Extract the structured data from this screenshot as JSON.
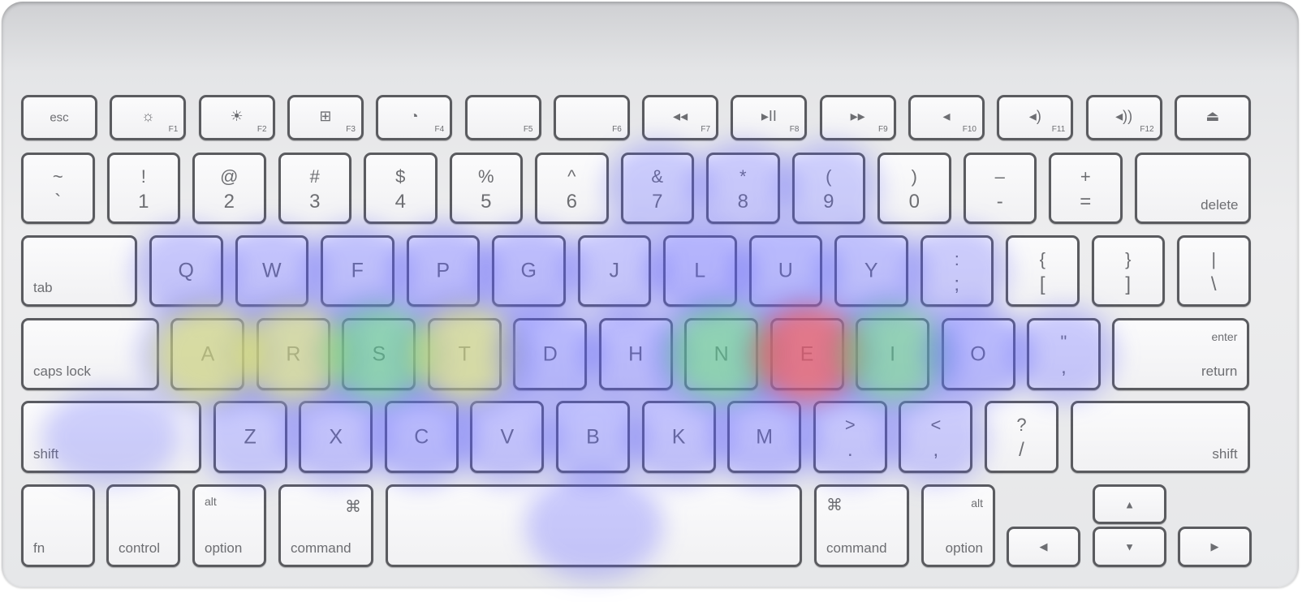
{
  "heat_colors": {
    "low": "#5a5cff",
    "mid": "#5ee06a",
    "high": "#e8f060",
    "max": "#f05a5a"
  },
  "rows": [
    [
      {
        "label": "esc"
      },
      {
        "icon": "brightness-down-icon",
        "fn": "F1"
      },
      {
        "icon": "brightness-up-icon",
        "fn": "F2"
      },
      {
        "icon": "mission-control-icon",
        "fn": "F3"
      },
      {
        "icon": "dashboard-icon",
        "fn": "F4"
      },
      {
        "fn": "F5"
      },
      {
        "fn": "F6"
      },
      {
        "icon": "rewind-icon",
        "fn": "F7"
      },
      {
        "icon": "play-pause-icon",
        "fn": "F8"
      },
      {
        "icon": "fast-forward-icon",
        "fn": "F9"
      },
      {
        "icon": "mute-icon",
        "fn": "F10"
      },
      {
        "icon": "volume-down-icon",
        "fn": "F11"
      },
      {
        "icon": "volume-up-icon",
        "fn": "F12"
      },
      {
        "icon": "eject-icon"
      }
    ],
    [
      {
        "top": "~",
        "bottom": "`"
      },
      {
        "top": "!",
        "bottom": "1"
      },
      {
        "top": "@",
        "bottom": "2"
      },
      {
        "top": "#",
        "bottom": "3"
      },
      {
        "top": "$",
        "bottom": "4"
      },
      {
        "top": "%",
        "bottom": "5"
      },
      {
        "top": "^",
        "bottom": "6"
      },
      {
        "top": "&",
        "bottom": "7",
        "heat": 0.1
      },
      {
        "top": "*",
        "bottom": "8",
        "heat": 0.12
      },
      {
        "top": "(",
        "bottom": "9",
        "heat": 0.06
      },
      {
        "top": ")",
        "bottom": "0"
      },
      {
        "top": "–",
        "bottom": "-"
      },
      {
        "top": "+",
        "bottom": "="
      },
      {
        "corner": "delete"
      }
    ],
    [
      {
        "corner_left": "tab"
      },
      {
        "label": "Q",
        "heat": 0.15
      },
      {
        "label": "W",
        "heat": 0.2
      },
      {
        "label": "F",
        "heat": 0.25
      },
      {
        "label": "P",
        "heat": 0.3
      },
      {
        "label": "G",
        "heat": 0.3
      },
      {
        "label": "J",
        "heat": 0.15
      },
      {
        "label": "L",
        "heat": 0.42
      },
      {
        "label": "U",
        "heat": 0.35
      },
      {
        "label": "Y",
        "heat": 0.25
      },
      {
        "top": ":",
        "bottom": ";",
        "heat": 0.08
      },
      {
        "top": "{",
        "bottom": "["
      },
      {
        "top": "}",
        "bottom": "]"
      },
      {
        "top": "|",
        "bottom": "\\"
      }
    ],
    [
      {
        "corner_left": "caps lock"
      },
      {
        "label": "A",
        "heat": 0.72
      },
      {
        "label": "R",
        "heat": 0.62
      },
      {
        "label": "S",
        "heat": 0.55
      },
      {
        "label": "T",
        "heat": 0.66
      },
      {
        "label": "D",
        "heat": 0.35
      },
      {
        "label": "H",
        "heat": 0.3
      },
      {
        "label": "N",
        "heat": 0.55
      },
      {
        "label": "E",
        "heat": 1.0
      },
      {
        "label": "I",
        "heat": 0.5
      },
      {
        "label": "O",
        "heat": 0.35
      },
      {
        "top": "\"",
        "bottom": ",",
        "heat": 0.12
      },
      {
        "corner": "return",
        "corner_top": "enter"
      }
    ],
    [
      {
        "corner_left": "shift",
        "heat": 0.05
      },
      {
        "label": "Z",
        "heat": 0.1
      },
      {
        "label": "X",
        "heat": 0.2
      },
      {
        "label": "C",
        "heat": 0.35
      },
      {
        "label": "V",
        "heat": 0.2
      },
      {
        "label": "B",
        "heat": 0.25
      },
      {
        "label": "K",
        "heat": 0.2
      },
      {
        "label": "M",
        "heat": 0.3
      },
      {
        "top": ">",
        "bottom": ".",
        "heat": 0.15
      },
      {
        "top": "<",
        "bottom": ",",
        "heat": 0.08
      },
      {
        "top": "?",
        "bottom": "/"
      },
      {
        "corner": "shift"
      }
    ],
    [
      {
        "corner_left": "fn"
      },
      {
        "corner_left": "control"
      },
      {
        "corner_left": "option",
        "corner_top_left": "alt"
      },
      {
        "corner_left": "command",
        "icon_tr": "command-icon"
      },
      {
        "label": "",
        "heat": 0.12
      },
      {
        "corner_left": "command",
        "icon_tl": "command-icon"
      },
      {
        "corner": "option",
        "corner_top": "alt"
      },
      {
        "icon": "arrow-up-icon"
      },
      {
        "icon": "arrow-left-icon"
      },
      {
        "icon": "arrow-down-icon"
      },
      {
        "icon": "arrow-right-icon"
      }
    ]
  ]
}
